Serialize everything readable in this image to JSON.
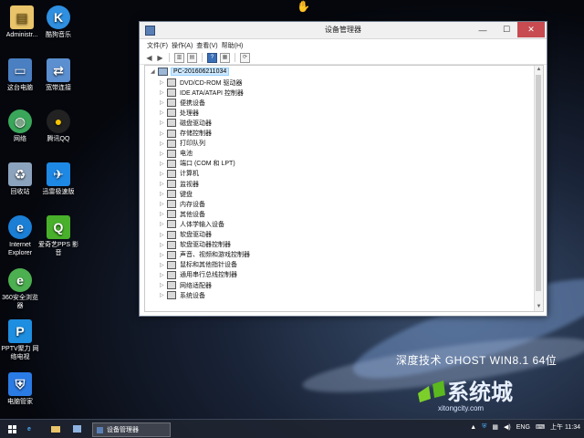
{
  "desktop": {
    "icons": [
      {
        "label": "Administr...",
        "icon": "folder-user-icon"
      },
      {
        "label": "酷狗音乐",
        "icon": "kugou-music-icon"
      },
      {
        "label": "这台电脑",
        "icon": "computer-icon"
      },
      {
        "label": "宽带连接",
        "icon": "broadband-icon"
      },
      {
        "label": "网络",
        "icon": "network-icon"
      },
      {
        "label": "腾讯QQ",
        "icon": "qq-icon"
      },
      {
        "label": "回收站",
        "icon": "recycle-bin-icon"
      },
      {
        "label": "迅雷极速版",
        "icon": "thunder-icon"
      },
      {
        "label": "Internet Explorer",
        "icon": "ie-icon"
      },
      {
        "label": "爱奇艺PPS 影音",
        "icon": "iqiyi-pps-icon"
      },
      {
        "label": "360安全浏览器",
        "icon": "360-browser-icon"
      },
      {
        "label": "PPTV聚力 网络电视",
        "icon": "pptv-icon"
      },
      {
        "label": "电脑管家",
        "icon": "pc-manager-icon"
      }
    ]
  },
  "window": {
    "title": "设备管理器",
    "menu": [
      "文件(F)",
      "操作(A)",
      "查看(V)",
      "帮助(H)"
    ],
    "root": "PC-201606211034",
    "items": [
      "DVD/CD-ROM 驱动器",
      "IDE ATA/ATAPI 控制器",
      "便携设备",
      "处理器",
      "磁盘驱动器",
      "存储控制器",
      "打印队列",
      "电池",
      "端口 (COM 和 LPT)",
      "计算机",
      "监视器",
      "键盘",
      "内存设备",
      "其他设备",
      "人体学输入设备",
      "软盘驱动器",
      "软盘驱动器控制器",
      "声音、视频和游戏控制器",
      "鼠标和其他指针设备",
      "通用串行总线控制器",
      "网络适配器",
      "系统设备"
    ]
  },
  "branding": {
    "edition": "深度技术  GHOST  WIN8.1  64位",
    "logo_text": "系统城",
    "logo_url": "xitongcity.com"
  },
  "taskbar": {
    "active_task": "设备管理器",
    "lang": "ENG",
    "clock": "上午 11:34"
  },
  "colors": {
    "accent": "#3b6fb6",
    "close": "#c74b50"
  }
}
